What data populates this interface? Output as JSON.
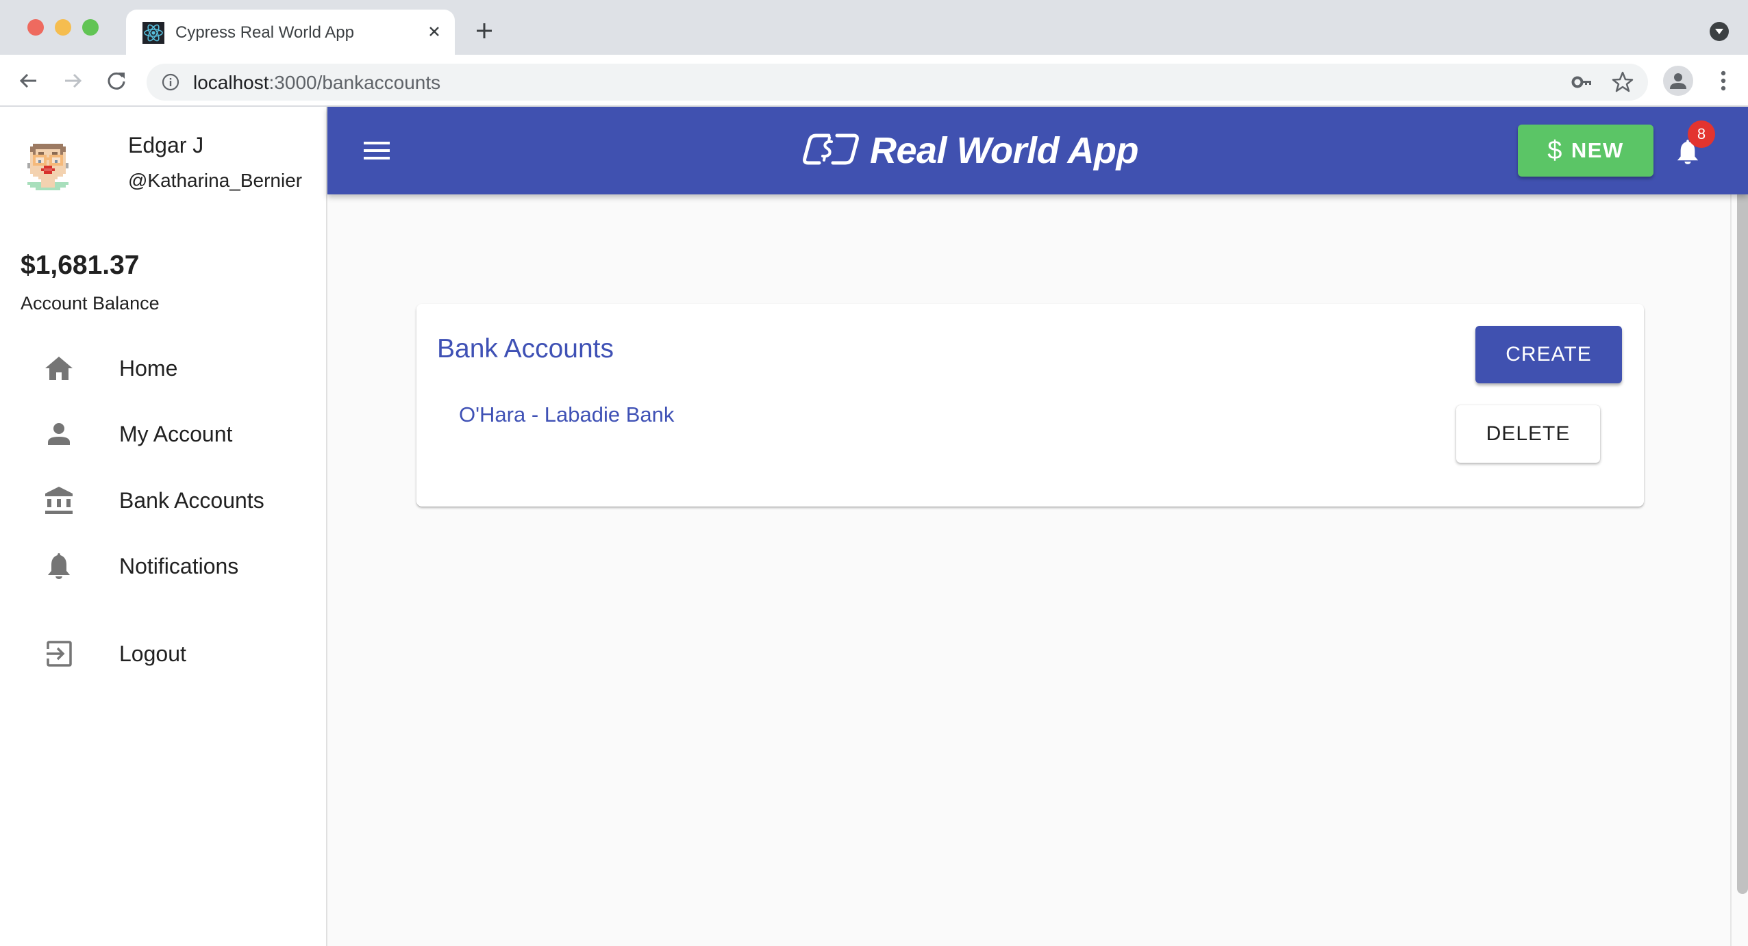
{
  "browser": {
    "tab_title": "Cypress Real World App",
    "url_host": "localhost",
    "url_rest": ":3000/bankaccounts",
    "icons": {
      "favicon": "react-atom-icon",
      "close": "close-icon",
      "new_tab": "plus-icon",
      "tab_search": "chevron-down-circle-icon",
      "back": "arrow-left-icon",
      "forward": "arrow-right-icon",
      "reload": "reload-icon",
      "site_info": "info-circle-icon",
      "password": "key-icon",
      "bookmark": "star-outline-icon",
      "profile": "account-circle-icon",
      "menu": "more-vertical-icon"
    },
    "traffic_lights": [
      "#ee6a5f",
      "#f5bd4f",
      "#61c454"
    ]
  },
  "sidebar": {
    "user": {
      "name": "Edgar J",
      "handle": "@Katharina_Bernier"
    },
    "balance": {
      "amount": "$1,681.37",
      "label": "Account Balance"
    },
    "nav": [
      {
        "label": "Home",
        "icon": "home-icon"
      },
      {
        "label": "My Account",
        "icon": "person-icon"
      },
      {
        "label": "Bank Accounts",
        "icon": "bank-icon"
      },
      {
        "label": "Notifications",
        "icon": "bell-icon"
      },
      {
        "label": "Logout",
        "icon": "logout-icon"
      }
    ]
  },
  "appbar": {
    "title": "Real World App",
    "new_button": {
      "symbol": "$",
      "label": "NEW"
    },
    "notification_count": "8",
    "colors": {
      "primary": "#4051b0",
      "new_button": "#5bc566",
      "badge": "#e3342f"
    }
  },
  "main": {
    "card_title": "Bank Accounts",
    "create_label": "CREATE",
    "bank_accounts": [
      {
        "name": "O'Hara - Labadie Bank",
        "delete_label": "DELETE"
      }
    ]
  }
}
